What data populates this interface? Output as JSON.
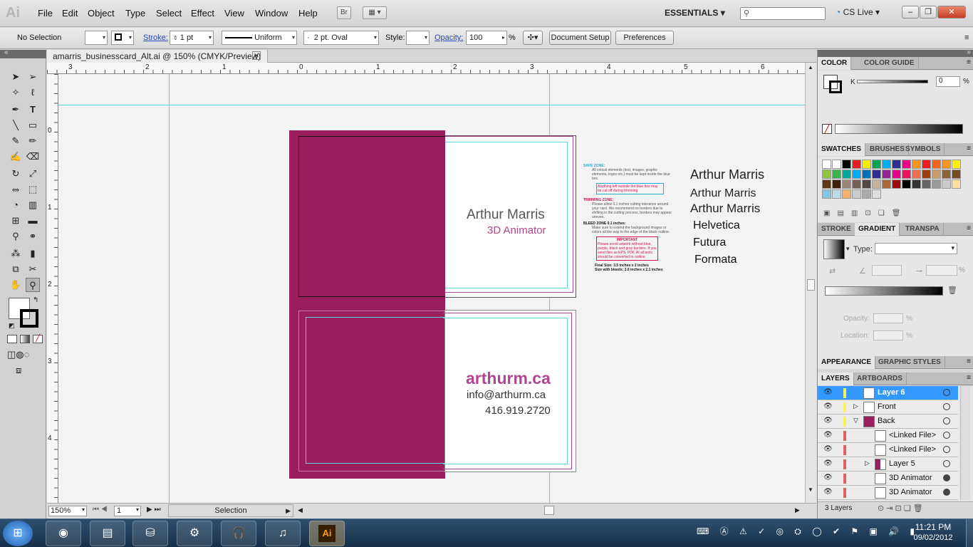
{
  "app": {
    "logo": "Ai",
    "menu": [
      "File",
      "Edit",
      "Object",
      "Type",
      "Select",
      "Effect",
      "View",
      "Window",
      "Help"
    ],
    "bridge_label": "Br",
    "workspace": "ESSENTIALS",
    "cslive": "CS Live"
  },
  "control_bar": {
    "selection": "No Selection",
    "stroke_label": "Stroke:",
    "stroke_weight": "1 pt",
    "profile": "Uniform",
    "brush": "2 pt. Oval",
    "style_label": "Style:",
    "opacity_label": "Opacity:",
    "opacity_value": "100",
    "percent": "%",
    "document_setup": "Document Setup",
    "preferences": "Preferences"
  },
  "document": {
    "tab_title": "amarris_businesscard_Alt.ai @ 150% (CMYK/Preview)",
    "zoom": "150%",
    "artboard_number": "1",
    "status_tool": "Selection",
    "ruler_h": [
      "3",
      "2",
      "1",
      "0",
      "1",
      "2",
      "3",
      "4",
      "5",
      "6"
    ],
    "ruler_v": [
      "0",
      "1",
      "2",
      "3",
      "4"
    ]
  },
  "card_front": {
    "name": "Arthur Marris",
    "title": "3D Animator"
  },
  "card_back": {
    "website": "arthurm.ca",
    "email": "info@arthurm.ca",
    "phone": "416.919.2720"
  },
  "template_notes": {
    "safe_title": "SAFE ZONE:",
    "safe_body": "All critical elements (text, images, graphic elements, logos etc.) must be kept inside the blue box.",
    "safe_warn": "Anything left outside the blue box may be cut off during trimming",
    "trim_title": "TRIMMING ZONE:",
    "trim_body": "Please allow 0.1 inches cutting tolerance around your card. We recommend no borders due to shifting in the cutting process, borders may appear uneven.",
    "bleed_title": "BLEED ZONE 0.1 inches:",
    "bleed_body": "Make sure to extend the background images or colors all the way to the edge of the black outline.",
    "important_title": "IMPORTANT",
    "important_body": "Please avoid artwork without blue, purple, black and gray borders. If you send files as EPS, PDF, AI all texts should be converted to outline",
    "final_size": "Final Size: 3.5 inches x 2 inches",
    "bleed_size": "Size with bleeds: 3.6 inches x 2.1 inches"
  },
  "font_samples": [
    "Arthur Marris",
    "Arthur Marris",
    "Arthur Marris",
    "Helvetica",
    "Futura",
    "Formata"
  ],
  "panels": {
    "color_tabs": [
      "COLOR",
      "COLOR GUIDE"
    ],
    "k_label": "K",
    "k_value": "0",
    "k_percent": "%",
    "swatch_tabs": [
      "SWATCHES",
      "BRUSHES",
      "SYMBOLS"
    ],
    "gradient_tabs": [
      "STROKE",
      "GRADIENT",
      "TRANSPA"
    ],
    "type_label": "Type:",
    "opacity_label": "Opacity:",
    "location_label": "Location:",
    "percent": "%",
    "appearance_tabs": [
      "APPEARANCE",
      "GRAPHIC STYLES"
    ],
    "layer_tabs": [
      "LAYERS",
      "ARTBOARDS"
    ],
    "layers": [
      "Layer 6",
      "Front",
      "Back",
      "<Linked File>",
      "<Linked File>",
      "Layer 5",
      "3D Animator",
      "3D Animator"
    ],
    "layer_count": "3 Layers"
  },
  "colors": {
    "magenta": "#9b1f5e",
    "guide_cyan": "#55d7e6",
    "accent_pink": "#b0468f",
    "selection_blue": "#3399ff"
  },
  "taskbar": {
    "clock_time": "11:21 PM",
    "clock_date": "09/02/2012",
    "ai_label": "Ai"
  }
}
